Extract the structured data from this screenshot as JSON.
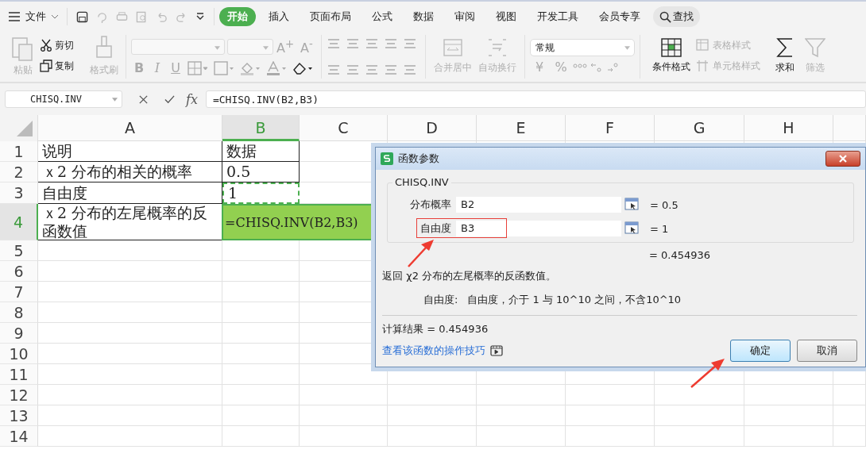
{
  "menu": {
    "file": "文件",
    "tabs": [
      {
        "label": "开始",
        "selected": true
      },
      {
        "label": "插入",
        "selected": false
      },
      {
        "label": "页面布局",
        "selected": false
      },
      {
        "label": "公式",
        "selected": false
      },
      {
        "label": "数据",
        "selected": false
      },
      {
        "label": "审阅",
        "selected": false
      },
      {
        "label": "视图",
        "selected": false
      },
      {
        "label": "开发工具",
        "selected": false
      },
      {
        "label": "会员专享",
        "selected": false
      }
    ],
    "search": "查找"
  },
  "ribbon": {
    "clipboard": [
      {
        "label": "粘贴",
        "kind": "paste",
        "disabled": true
      },
      {
        "label": "剪切",
        "kind": "cut",
        "disabled": false
      },
      {
        "label": "复制",
        "kind": "copy",
        "disabled": false
      },
      {
        "label": "格式刷",
        "kind": "brush",
        "disabled": true
      }
    ],
    "font_sizes": [
      "A$^{+}$",
      "A$^{-}$"
    ],
    "font_styles": [
      "B",
      "I",
      "U"
    ],
    "align": [
      {
        "label": "合并居中",
        "kind": "merge",
        "disabled": true
      },
      {
        "label": "自动换行",
        "kind": "wrap",
        "disabled": true
      }
    ],
    "number_format": "常规",
    "number_symbols": [
      "¥",
      "%"
    ],
    "styles": [
      {
        "label": "条件格式",
        "kind": "cond",
        "disabled": false
      },
      {
        "label": "表格样式",
        "kind": "table",
        "disabled": true
      },
      {
        "label": "单元格样式",
        "kind": "cellstyle",
        "disabled": true
      },
      {
        "label": "求和",
        "kind": "sum",
        "disabled": false
      },
      {
        "label": "筛选",
        "kind": "filter",
        "disabled": true
      }
    ]
  },
  "formula_bar": {
    "name_box": "CHISQ.INV",
    "fx": "fx",
    "formula": "=CHISQ.INV(B2,B3)"
  },
  "sheet": {
    "columns": [
      {
        "label": "A",
        "selected": false
      },
      {
        "label": "B",
        "selected": true
      },
      {
        "label": "C",
        "selected": false
      },
      {
        "label": "D",
        "selected": false
      },
      {
        "label": "E",
        "selected": false
      },
      {
        "label": "F",
        "selected": false
      },
      {
        "label": "G",
        "selected": false
      },
      {
        "label": "H",
        "selected": false
      }
    ],
    "rows": [
      {
        "label": "1",
        "selected": false,
        "cells": [
          {
            "text": "说明",
            "kind": "value"
          },
          {
            "text": "数据",
            "kind": "value"
          }
        ]
      },
      {
        "label": "2",
        "selected": false,
        "cells": [
          {
            "text": "ｘ2 分布的相关的概率",
            "kind": "value"
          },
          {
            "text": "0.5",
            "kind": "value"
          }
        ]
      },
      {
        "label": "3",
        "selected": false,
        "cells": [
          {
            "text": "自由度",
            "kind": "value"
          },
          {
            "text": "1",
            "kind": "referenced"
          }
        ]
      },
      {
        "label": "4",
        "selected": true,
        "cells": [
          {
            "text": "ｘ2 分布的左尾概率的反函数值",
            "kind": "value"
          },
          {
            "text": "=CHISQ.INV(B2,B3)",
            "kind": "editing"
          }
        ]
      },
      {
        "label": "5",
        "selected": false,
        "cells": []
      },
      {
        "label": "6",
        "selected": false,
        "cells": []
      },
      {
        "label": "7",
        "selected": false,
        "cells": []
      },
      {
        "label": "8",
        "selected": false,
        "cells": []
      },
      {
        "label": "9",
        "selected": false,
        "cells": []
      },
      {
        "label": "10",
        "selected": false,
        "cells": []
      },
      {
        "label": "11",
        "selected": false,
        "cells": []
      },
      {
        "label": "12",
        "selected": false,
        "cells": []
      },
      {
        "label": "13",
        "selected": false,
        "cells": []
      },
      {
        "label": "14",
        "selected": false,
        "cells": []
      }
    ]
  },
  "dialog": {
    "title": "函数参数",
    "function": "CHISQ.INV",
    "args": [
      {
        "label": "分布概率",
        "value": "B2",
        "result": "= 0.5",
        "highlighted": false
      },
      {
        "label": "自由度",
        "value": "B3",
        "result": "= 1",
        "highlighted": true
      }
    ],
    "formula_result": "= 0.454936",
    "description": "返回 χ2 分布的左尾概率的反函数值。",
    "arg_help_label": "自由度:",
    "arg_help": "自由度，介于 1 与 10^10 之间，不含10^10",
    "calc_result": "计算结果 = 0.454936",
    "link": "查看该函数的操作技巧",
    "buttons": [
      {
        "label": "确定",
        "default": true
      },
      {
        "label": "取消",
        "default": false
      }
    ]
  }
}
